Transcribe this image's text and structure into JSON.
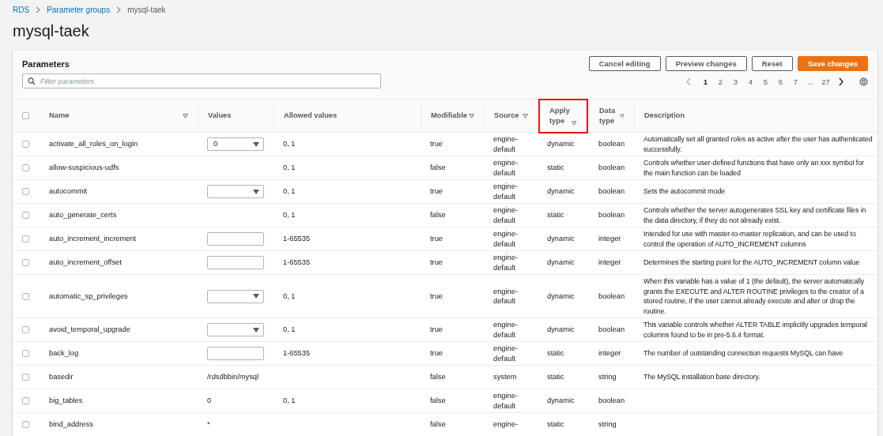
{
  "breadcrumb": [
    {
      "label": "RDS",
      "link": true
    },
    {
      "label": "Parameter groups",
      "link": true
    },
    {
      "label": "mysql-taek",
      "link": false
    }
  ],
  "title": "mysql-taek",
  "panel": {
    "title": "Parameters",
    "buttons": [
      {
        "label": "Cancel editing",
        "kind": "normal"
      },
      {
        "label": "Preview changes",
        "kind": "normal"
      },
      {
        "label": "Reset",
        "kind": "normal"
      },
      {
        "label": "Save changes",
        "kind": "primary"
      }
    ],
    "filter": {
      "placeholder": "Filter parameters"
    },
    "pagination": [
      {
        "label": "1",
        "selected": true
      },
      {
        "label": "2",
        "selected": false
      },
      {
        "label": "3",
        "selected": false
      },
      {
        "label": "4",
        "selected": false
      },
      {
        "label": "5",
        "selected": false
      },
      {
        "label": "6",
        "selected": false
      },
      {
        "label": "7",
        "selected": false
      },
      {
        "label": "...",
        "selected": false
      },
      {
        "label": "27",
        "selected": false
      }
    ]
  },
  "table": {
    "select_all": {
      "checked": false
    },
    "columns": [
      {
        "label": "Name",
        "sortable": true,
        "highlighted": false
      },
      {
        "label": "Values",
        "sortable": false,
        "highlighted": false
      },
      {
        "label": "Allowed values",
        "sortable": false,
        "highlighted": false
      },
      {
        "label": "Modifiable",
        "sortable": true,
        "highlighted": false
      },
      {
        "label": "Source",
        "sortable": true,
        "highlighted": false
      },
      {
        "label": "Apply type",
        "sortable": true,
        "highlighted": true
      },
      {
        "label": "Data type",
        "sortable": true,
        "highlighted": false
      },
      {
        "label": "Description",
        "sortable": false,
        "highlighted": false
      }
    ],
    "rows": [
      {
        "checked": false,
        "name": "activate_all_roles_on_login",
        "value": {
          "kind": "select",
          "text": "0"
        },
        "allowed": "0, 1",
        "modifiable": "true",
        "source": "engine-default",
        "apply_type": "dynamic",
        "data_type": "boolean",
        "description": "Automatically set all granted roles as active after the user has authenticated successfully."
      },
      {
        "checked": false,
        "name": "allow-suspicious-udfs",
        "value": {
          "kind": "none"
        },
        "allowed": "0, 1",
        "modifiable": "false",
        "source": "engine-default",
        "apply_type": "static",
        "data_type": "boolean",
        "description": "Controls whether user-defined functions that have only an xxx symbol for the main function can be loaded"
      },
      {
        "checked": false,
        "name": "autocommit",
        "value": {
          "kind": "select"
        },
        "allowed": "0, 1",
        "modifiable": "true",
        "source": "engine-default",
        "apply_type": "dynamic",
        "data_type": "boolean",
        "description": "Sets the autocommit mode"
      },
      {
        "checked": false,
        "name": "auto_generate_certs",
        "value": {
          "kind": "none"
        },
        "allowed": "0, 1",
        "modifiable": "false",
        "source": "engine-default",
        "apply_type": "static",
        "data_type": "boolean",
        "description": "Controls whether the server autogenerates SSL key and certificate files in the data directory, if they do not already exist."
      },
      {
        "checked": false,
        "name": "auto_increment_increment",
        "value": {
          "kind": "input"
        },
        "allowed": "1-65535",
        "modifiable": "true",
        "source": "engine-default",
        "apply_type": "dynamic",
        "data_type": "integer",
        "description": "Intended for use with master-to-master replication, and can be used to control the operation of AUTO_INCREMENT columns"
      },
      {
        "checked": false,
        "name": "auto_increment_offset",
        "value": {
          "kind": "input"
        },
        "allowed": "1-65535",
        "modifiable": "true",
        "source": "engine-default",
        "apply_type": "dynamic",
        "data_type": "integer",
        "description": "Determines the starting point for the AUTO_INCREMENT column value"
      },
      {
        "checked": false,
        "name": "automatic_sp_privileges",
        "value": {
          "kind": "select"
        },
        "allowed": "0, 1",
        "modifiable": "true",
        "source": "engine-default",
        "apply_type": "dynamic",
        "data_type": "boolean",
        "description": "When this variable has a value of 1 (the default), the server automatically grants the EXECUTE and ALTER ROUTINE privileges to the creator of a stored routine, if the user cannot already execute and alter or drop the routine."
      },
      {
        "checked": false,
        "name": "avoid_temporal_upgrade",
        "value": {
          "kind": "select"
        },
        "allowed": "0, 1",
        "modifiable": "true",
        "source": "engine-default",
        "apply_type": "dynamic",
        "data_type": "boolean",
        "description": "This variable controls whether ALTER TABLE implicitly upgrades temporal columns found to be in pre-5.6.4 format."
      },
      {
        "checked": false,
        "name": "back_log",
        "value": {
          "kind": "input"
        },
        "allowed": "1-65535",
        "modifiable": "true",
        "source": "engine-default",
        "apply_type": "static",
        "data_type": "integer",
        "description": "The number of outstanding connection requests MySQL can have"
      },
      {
        "checked": false,
        "name": "basedir",
        "value": {
          "kind": "text",
          "text": "/rdsdbbin/mysql"
        },
        "modifiable": "false",
        "source": "system",
        "apply_type": "static",
        "data_type": "string",
        "description": "The MySQL installation base directory."
      },
      {
        "checked": false,
        "name": "big_tables",
        "value": {
          "kind": "text",
          "text": "0"
        },
        "allowed": "0, 1",
        "modifiable": "false",
        "source": "engine-default",
        "apply_type": "dynamic",
        "data_type": "boolean"
      },
      {
        "checked": false,
        "name": "bind_address",
        "value": {
          "kind": "text",
          "text": "*"
        },
        "modifiable": "false",
        "source": "engine-",
        "apply_type": "static",
        "data_type": "string"
      }
    ]
  }
}
